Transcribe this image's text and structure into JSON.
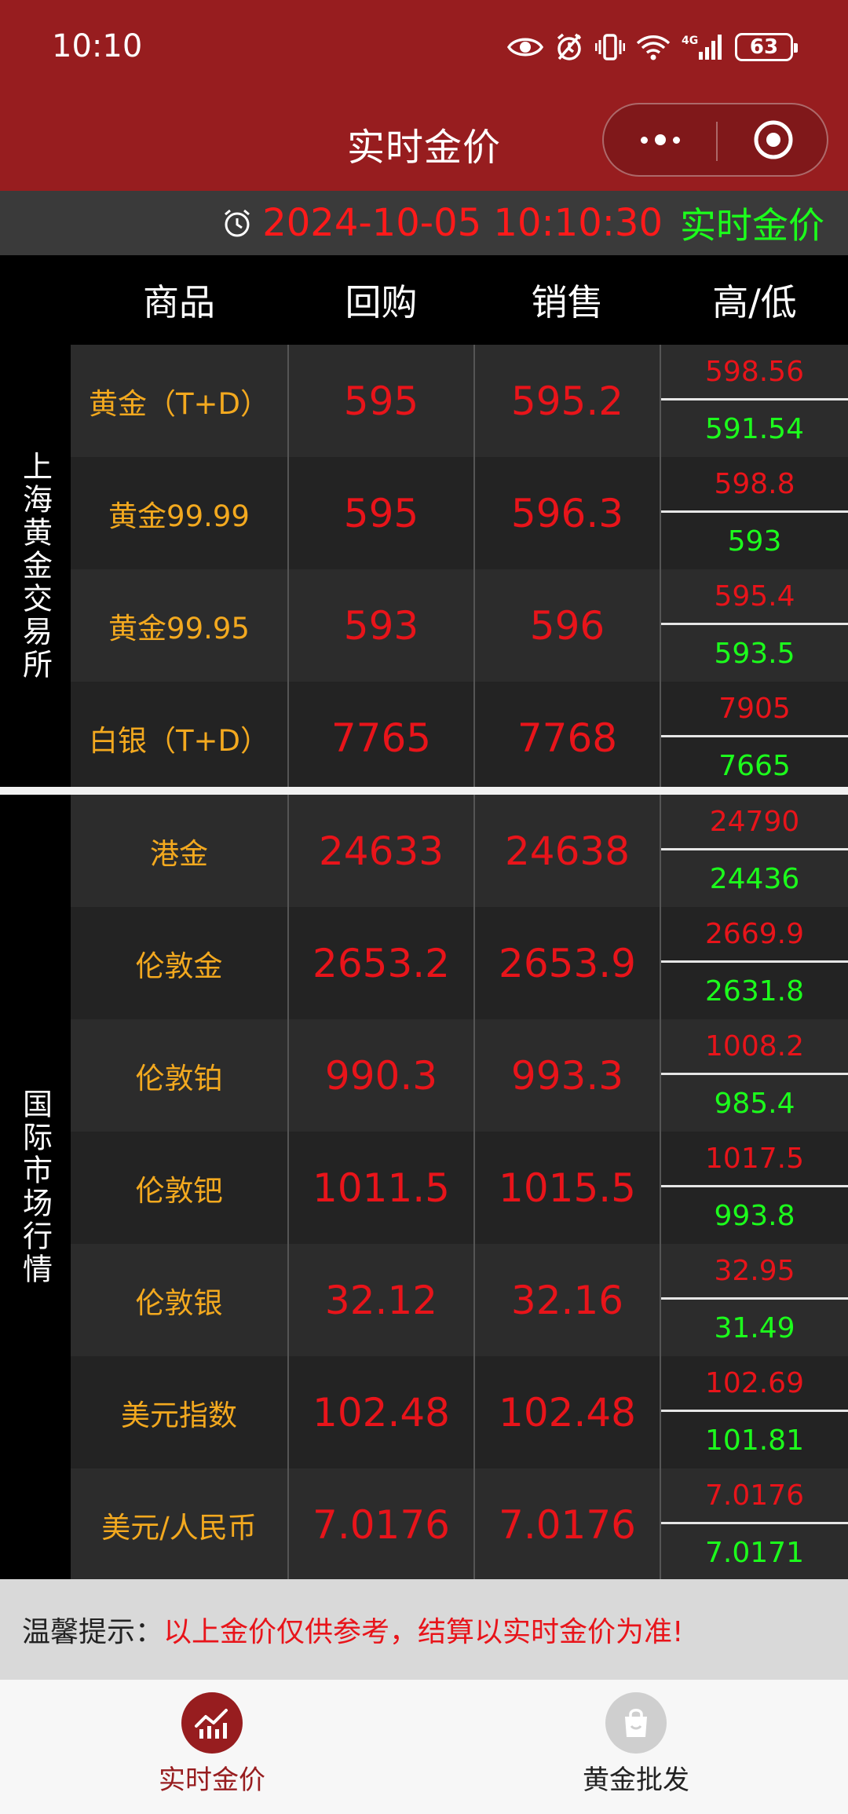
{
  "status_bar": {
    "time": "10:10",
    "battery": "63",
    "icons": [
      "eye-icon",
      "alarm-icon",
      "vibrate-icon",
      "wifi-icon",
      "4g-signal-icon",
      "battery-icon"
    ]
  },
  "header": {
    "title": "实时金价",
    "more_icon": "more-dots-icon",
    "close_icon": "target-close-icon"
  },
  "time_bar": {
    "datetime": "2024-10-05 10:10:30",
    "label": "实时金价"
  },
  "columns": [
    "商品",
    "回购",
    "销售",
    "高/低"
  ],
  "sections": [
    {
      "label": "上海黄金交易所",
      "rows": [
        {
          "name": "黄金（T+D）",
          "buy": "595",
          "sell": "595.2",
          "high": "598.56",
          "low": "591.54"
        },
        {
          "name": "黄金99.99",
          "buy": "595",
          "sell": "596.3",
          "high": "598.8",
          "low": "593"
        },
        {
          "name": "黄金99.95",
          "buy": "593",
          "sell": "596",
          "high": "595.4",
          "low": "593.5"
        },
        {
          "name": "白银（T+D）",
          "buy": "7765",
          "sell": "7768",
          "high": "7905",
          "low": "7665"
        }
      ]
    },
    {
      "label": "国际市场行情",
      "rows": [
        {
          "name": "港金",
          "buy": "24633",
          "sell": "24638",
          "high": "24790",
          "low": "24436"
        },
        {
          "name": "伦敦金",
          "buy": "2653.2",
          "sell": "2653.9",
          "high": "2669.9",
          "low": "2631.8"
        },
        {
          "name": "伦敦铂",
          "buy": "990.3",
          "sell": "993.3",
          "high": "1008.2",
          "low": "985.4"
        },
        {
          "name": "伦敦钯",
          "buy": "1011.5",
          "sell": "1015.5",
          "high": "1017.5",
          "low": "993.8"
        },
        {
          "name": "伦敦银",
          "buy": "32.12",
          "sell": "32.16",
          "high": "32.95",
          "low": "31.49"
        },
        {
          "name": "美元指数",
          "buy": "102.48",
          "sell": "102.48",
          "high": "102.69",
          "low": "101.81"
        },
        {
          "name": "美元/人民币",
          "buy": "7.0176",
          "sell": "7.0176",
          "high": "7.0176",
          "low": "7.0171"
        }
      ]
    }
  ],
  "tip": {
    "label": "温馨提示：",
    "message": "以上金价仅供参考，结算以实时金价为准!"
  },
  "tabs": [
    {
      "label": "实时金价",
      "icon": "chart-icon",
      "active": true
    },
    {
      "label": "黄金批发",
      "icon": "shopping-bag-icon",
      "active": false
    }
  ],
  "colors": {
    "header_bg": "#971d1f",
    "price_red": "#e8141a",
    "low_green": "#1cff1c",
    "name_gold": "#f3a91f",
    "tab_active": "#971d1f",
    "tab_inactive_icon": "#cfcfcf"
  }
}
